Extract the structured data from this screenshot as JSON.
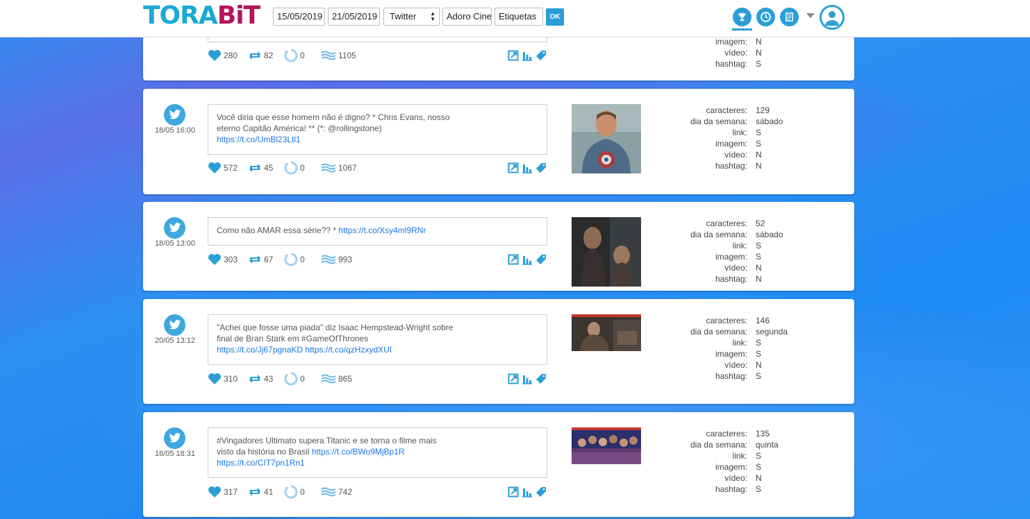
{
  "app": {
    "logo_part1": "TORA",
    "logo_part2": "BiT",
    "date_from": "15/05/2019",
    "date_to": "21/05/2019",
    "network": "Twitter",
    "profile": "Adoro Cinema",
    "tags_label": "Etiquetas",
    "ok_label": "OK",
    "accent": "#2a9fd6"
  },
  "meta_labels": {
    "characters": "caracteres:",
    "weekday": "dia da semana:",
    "link": "link:",
    "image": "imagem:",
    "video": "vídeo:",
    "hashtag": "hashtag:"
  },
  "partial_card": {
    "likes": "280",
    "retweets": "82",
    "replies": "0",
    "reach": "1105",
    "image": "N",
    "video": "N",
    "hashtag": "S"
  },
  "posts": [
    {
      "date": "18/05 16:00",
      "text_line1": "Você diria que esse homem não é digno? * Chris Evans, nosso",
      "text_line2": "eterno Capitão América! ** (*: @rollingstone)",
      "link1": "https://t.co/UmBl23Ltl1",
      "likes": "572",
      "retweets": "45",
      "replies": "0",
      "reach": "1067",
      "characters": "129",
      "weekday": "sábado",
      "link": "S",
      "image": "S",
      "video": "N",
      "hashtag": "N"
    },
    {
      "date": "18/05 13:00",
      "text_line1": "Como não AMAR essa série?? * ",
      "link1": "https://t.co/Xsy4ml9RNr",
      "likes": "303",
      "retweets": "67",
      "replies": "0",
      "reach": "993",
      "characters": "52",
      "weekday": "sábado",
      "link": "S",
      "image": "S",
      "video": "N",
      "hashtag": "N"
    },
    {
      "date": "20/05 13:12",
      "text_line1": "\"Achei que fosse uma piada\" diz Isaac Hempstead-Wright sobre",
      "text_line2": "final de Bran Stark em #GameOfThrones",
      "link1": "https://t.co/Jj67pgnaKD",
      "link2": "https://t.co/qzHzxydXUI",
      "likes": "310",
      "retweets": "43",
      "replies": "0",
      "reach": "865",
      "characters": "146",
      "weekday": "segunda",
      "link": "S",
      "image": "S",
      "video": "N",
      "hashtag": "S"
    },
    {
      "date": "16/05 18:31",
      "text_line1": "#Vingadores Ultimato supera Titanic e se torna o filme mais",
      "text_line2": "visto da história no Brasil ",
      "link1": "https://t.co/BWo9MjBp1R",
      "link2": "https://t.co/CIT7pn1Rn1",
      "likes": "317",
      "retweets": "41",
      "replies": "0",
      "reach": "742",
      "characters": "135",
      "weekday": "quinta",
      "link": "S",
      "image": "S",
      "video": "N",
      "hashtag": "S"
    }
  ]
}
